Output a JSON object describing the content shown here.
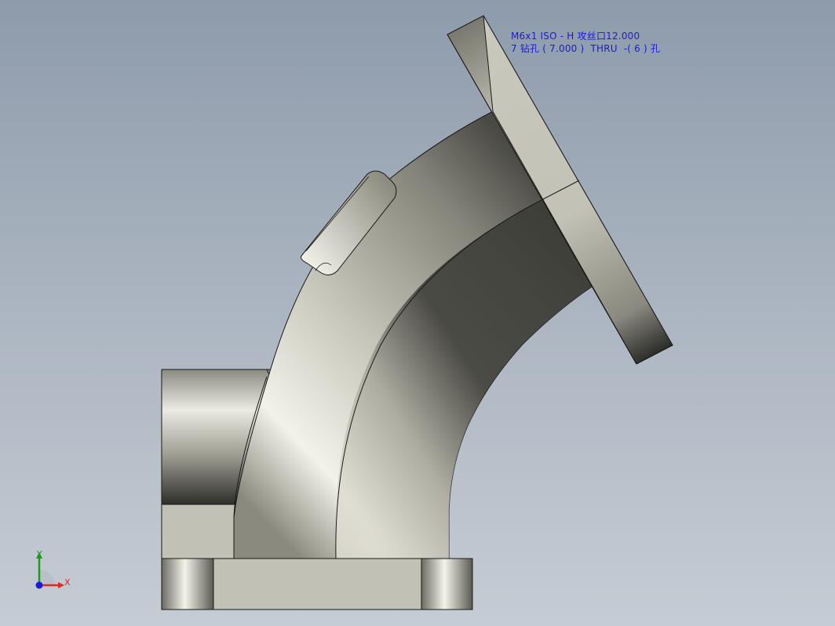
{
  "annotation": {
    "line1": "M6x1 ISO - H 攻丝口12.000",
    "line2": "7 钻孔 ( 7.000 )  THRU  -( 6 ) 孔"
  },
  "triad": {
    "x_label": "X",
    "y_label": "Y"
  },
  "colors": {
    "background_top": "#8e9bab",
    "background_bottom": "#c6ccd4",
    "annotation_text": "#1a1adc",
    "axis_x": "#e0281e",
    "axis_y": "#1c9a1c",
    "axis_z": "#1a1adc"
  }
}
